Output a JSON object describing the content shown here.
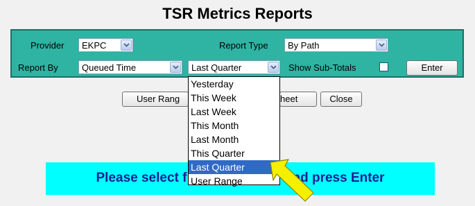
{
  "page": {
    "title": "TSR Metrics Reports"
  },
  "filters": {
    "provider_label": "Provider",
    "provider_value": "EKPC",
    "report_type_label": "Report Type",
    "report_type_value": "By Path",
    "report_by_label": "Report By",
    "report_by_value": "Queued Time",
    "period_value": "Last Quarter",
    "show_subtotals_label": "Show Sub-Totals",
    "show_subtotals_checked": false,
    "enter_label": "Enter"
  },
  "actions": {
    "user_range_label": "User Rang",
    "sheet_label": "heet",
    "close_label": "Close"
  },
  "period_dropdown": {
    "options": [
      "Yesterday",
      "This Week",
      "Last Week",
      "This Month",
      "Last Month",
      "This Quarter",
      "Last Quarter",
      "User Range"
    ],
    "selected": "Last Quarter"
  },
  "banner": {
    "text_left": "Please select f",
    "text_right": "nd press Enter",
    "color": "#00ffff",
    "text_color": "#1c1c94"
  },
  "colors": {
    "panel": "#2fb3a3",
    "selection": "#316ac5",
    "pointer": "#f5f000"
  },
  "icons": {
    "combo_arrow": "chevron-down-icon",
    "pointer": "arrow-pointer-icon"
  }
}
